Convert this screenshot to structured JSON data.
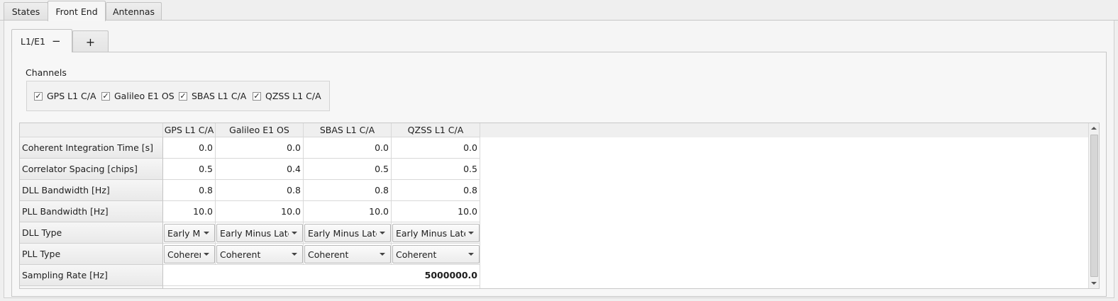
{
  "top_tabs": [
    "States",
    "Front End",
    "Antennas"
  ],
  "inner_tabs": {
    "active_label": "L1/E1",
    "remove_glyph": "−",
    "add_glyph": "+"
  },
  "channels": {
    "title": "Channels",
    "check_glyph": "✓",
    "items": [
      {
        "label": "GPS L1 C/A",
        "checked": true
      },
      {
        "label": "Galileo E1 OS",
        "checked": true
      },
      {
        "label": "SBAS L1 C/A",
        "checked": true
      },
      {
        "label": "QZSS L1 C/A",
        "checked": true
      }
    ]
  },
  "table": {
    "columns": [
      "GPS L1 C/A",
      "Galileo E1 OS",
      "SBAS L1 C/A",
      "QZSS L1 C/A"
    ],
    "rows": [
      {
        "label": "Coherent Integration Time [s]",
        "values": [
          "0.0",
          "0.0",
          "0.0",
          "0.0"
        ]
      },
      {
        "label": "Correlator Spacing [chips]",
        "values": [
          "0.5",
          "0.4",
          "0.5",
          "0.5"
        ]
      },
      {
        "label": "DLL Bandwidth [Hz]",
        "values": [
          "0.8",
          "0.8",
          "0.8",
          "0.8"
        ]
      },
      {
        "label": "PLL Bandwidth [Hz]",
        "values": [
          "10.0",
          "10.0",
          "10.0",
          "10.0"
        ]
      },
      {
        "label": "DLL Type",
        "values": [
          "Early Mi",
          "Early Minus Late",
          "Early Minus Late",
          "Early Minus Late"
        ]
      },
      {
        "label": "PLL Type",
        "values": [
          "Coherer",
          "Coherent",
          "Coherent",
          "Coherent"
        ]
      },
      {
        "label": "Sampling Rate [Hz]",
        "value": "5000000.0"
      }
    ]
  }
}
